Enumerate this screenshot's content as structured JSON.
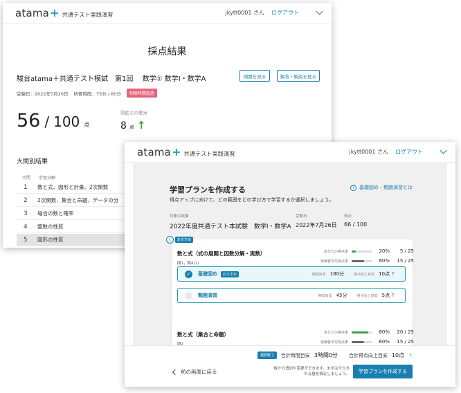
{
  "colors": {
    "accent": "#1a7fb0",
    "good_bar": "#3aa040",
    "neutral_bar": "#666666",
    "badge_pink": "#e8617a"
  },
  "back": {
    "header": {
      "logo": "atama",
      "logo_plus": "+",
      "subtitle": "共通テスト実践演習",
      "user": "jkytt0001 さん",
      "logout": "ログアウト"
    },
    "title": "採点結果",
    "exam_name": "駿台atama＋共通テスト模試　第1回　 数学① 数学Ⅰ・数学A",
    "btn_problem": "問題を見る",
    "btn_answer": "解答・解説を見る",
    "meta_date": "受験日：2022年7月26日",
    "meta_time": "所要時間：75分 / 60分",
    "overtime_badge": "制限時間超過",
    "score": "56",
    "score_sep": "/",
    "score_total": "100",
    "score_unit": "点",
    "diff_label": "前回との差分",
    "diff_value": "8",
    "diff_unit": "点",
    "diff_icon": "arrow-up-icon",
    "section_title": "大問別結果",
    "table_headers": {
      "num": "大問",
      "field": "学習分野"
    },
    "rows": [
      {
        "n": "1",
        "field": "数と式、図形と計量、2次関数"
      },
      {
        "n": "2",
        "field": "2次関数、集合と命題、データの分"
      },
      {
        "n": "3",
        "field": "場合の数と確率"
      },
      {
        "n": "4",
        "field": "整数の性質"
      },
      {
        "n": "5",
        "field": "図形の性質"
      }
    ]
  },
  "front": {
    "header": {
      "logo": "atama",
      "logo_plus": "+",
      "subtitle": "共通テスト実践演習",
      "user": "jkytt0001 さん",
      "logout": "ログアウト"
    },
    "title": "学習プランを作成する",
    "help_link": "基礎固め・類題演習とは",
    "description": "得点アップに向けて、どの範囲をどの学び方で学習するか選択しましょう。",
    "target_label": "対象の試験",
    "target_value": "2022年度共通テスト本試験　数学Ⅰ・数学A",
    "date_label": "受験日",
    "date_value": "2022年7月26日",
    "score_label": "得点",
    "score_value": "66 / 100",
    "card1": {
      "number": "1",
      "recommend_tag": "おすすめ",
      "title": "数と式（式の展開と因数分解・実数）",
      "sub": "問1，問4(1)",
      "your_rate_label": "あなたの得点率",
      "your_rate": 20,
      "your_rate_text": "20%",
      "your_score": "5 / 25",
      "avg_rate_label": "受験者平均得点率",
      "avg_rate": 60,
      "avg_rate_text": "60%",
      "avg_score": "15 / 25",
      "options": [
        {
          "name": "基礎固め",
          "tag": "おすすめ",
          "time_label": "時間目安",
          "time": "180分",
          "gain_label": "得点向上目安",
          "gain": "10点",
          "selected": true
        },
        {
          "name": "類題演習",
          "tag": "",
          "time_label": "時間目安",
          "time": "45分",
          "gain_label": "得点向上目安",
          "gain": "5点",
          "selected": false
        }
      ]
    },
    "card2": {
      "title": "数と式（集合と命題）",
      "sub": "問2",
      "your_rate_label": "あなたの得点率",
      "your_rate": 80,
      "your_rate_text": "80%",
      "your_score": "20 / 25",
      "avg_rate_label": "受験者平均得点率",
      "avg_rate": 60,
      "avg_rate_text": "60%",
      "avg_score": "15 / 25"
    },
    "footer": {
      "selected_count": "選択数 1",
      "total_time_label": "合計時間目安",
      "total_time": "3時間0分",
      "total_gain_label": "合計得点向上目安",
      "total_gain": "10点",
      "back_label": "前の画面に戻る",
      "note": "後から追加や変更ができます。まずはやりきれる量を設定しましょう。",
      "create_button": "学習プランを作成する"
    }
  }
}
